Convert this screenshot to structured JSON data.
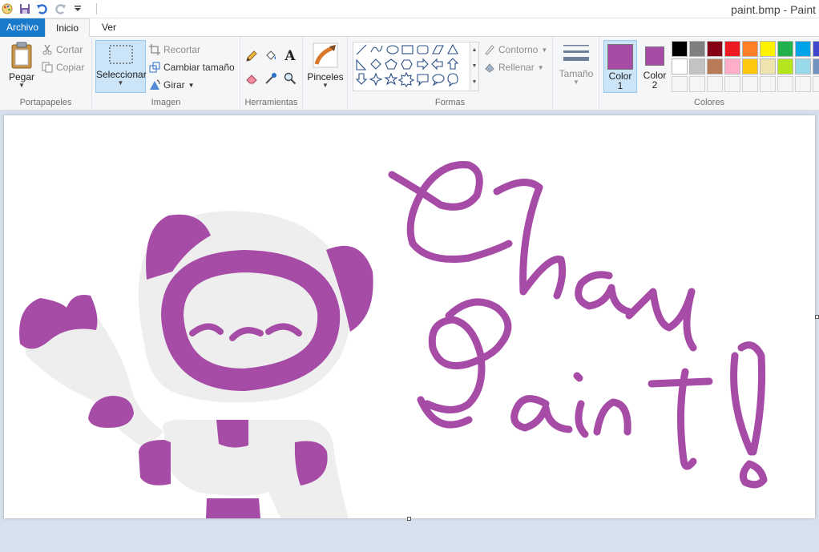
{
  "window": {
    "title": "paint.bmp - Paint"
  },
  "quick_access": {
    "icons": [
      "paint-app-icon",
      "save-icon",
      "undo-icon",
      "redo-icon",
      "customize-icon"
    ]
  },
  "tabs": {
    "file": "Archivo",
    "home": "Inicio",
    "view": "Ver"
  },
  "clipboard": {
    "paste": "Pegar",
    "cut": "Cortar",
    "copy": "Copiar",
    "label": "Portapapeles"
  },
  "image": {
    "select": "Seleccionar",
    "crop": "Recortar",
    "resize": "Cambiar tamaño",
    "rotate": "Girar",
    "label": "Imagen"
  },
  "tools": {
    "label": "Herramientas"
  },
  "brushes": {
    "label": "Pinceles"
  },
  "shapes": {
    "outline": "Contorno",
    "fill": "Rellenar",
    "label": "Formas"
  },
  "size": {
    "label": "Tamaño"
  },
  "colors": {
    "color1_label": "Color\n1",
    "color1_a": "Color",
    "color1_b": "1",
    "color2_a": "Color",
    "color2_b": "2",
    "label": "Colores",
    "color1": "#a64ca6",
    "color2": "#a64ca6",
    "palette_row1": [
      "#000000",
      "#7f7f7f",
      "#880015",
      "#ed1c24",
      "#ff7f27",
      "#fff200",
      "#22b14c",
      "#00a2e8",
      "#3f48cc",
      "#a349a4"
    ],
    "palette_row2": [
      "#ffffff",
      "#c3c3c3",
      "#b97a57",
      "#ffaec9",
      "#ffc90e",
      "#efe4b0",
      "#b5e61d",
      "#99d9ea",
      "#7092be",
      "#c8bfe7"
    ]
  },
  "canvas": {
    "background": "#ffffff",
    "paint_purple": "#a64ca6",
    "paint_gray": "#eeeeee"
  }
}
